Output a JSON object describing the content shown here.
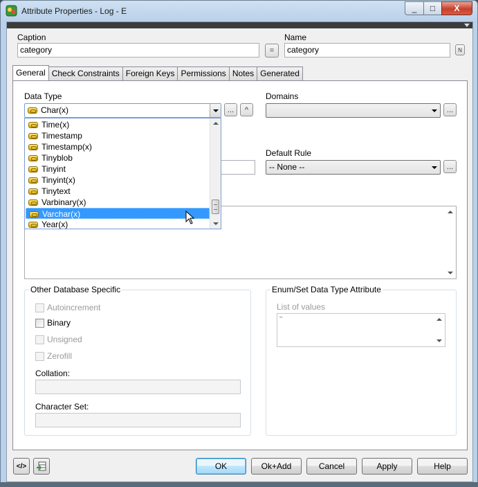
{
  "window": {
    "title": "Attribute Properties - Log - E"
  },
  "caption": {
    "label": "Caption",
    "value": "category",
    "equals_label": "="
  },
  "name": {
    "label": "Name",
    "value": "category",
    "n_label": "N"
  },
  "tabs": [
    {
      "label": "General"
    },
    {
      "label": "Check Constraints"
    },
    {
      "label": "Foreign Keys"
    },
    {
      "label": "Permissions"
    },
    {
      "label": "Notes"
    },
    {
      "label": "Generated"
    }
  ],
  "datatype": {
    "label": "Data Type",
    "selected": "Char(x)",
    "ellipsis": "...",
    "up": "^",
    "options": [
      {
        "label": "Time(x)"
      },
      {
        "label": "Timestamp"
      },
      {
        "label": "Timestamp(x)"
      },
      {
        "label": "Tinyblob"
      },
      {
        "label": "Tinyint"
      },
      {
        "label": "Tinyint(x)"
      },
      {
        "label": "Tinytext"
      },
      {
        "label": "Varbinary(x)"
      },
      {
        "label": "Varchar(x)"
      },
      {
        "label": "Year(x)"
      }
    ],
    "highlighted": "Varchar(x)"
  },
  "domains": {
    "label": "Domains",
    "value": "",
    "ellipsis": "..."
  },
  "default_rule": {
    "label": "Default Rule",
    "value": "-- None --",
    "ellipsis": "..."
  },
  "other_db": {
    "title": "Other Database Specific",
    "autoincrement": "Autoincrement",
    "binary": "Binary",
    "unsigned": "Unsigned",
    "zerofill": "Zerofill",
    "collation_label": "Collation:",
    "charset_label": "Character Set:"
  },
  "enumset": {
    "title": "Enum/Set Data Type Attribute",
    "list_label": "List of values",
    "list_value": "\""
  },
  "buttons": {
    "ok": "OK",
    "ok_add": "Ok+Add",
    "cancel": "Cancel",
    "apply": "Apply",
    "help": "Help",
    "left1": "</>"
  },
  "window_buttons": {
    "min": "_",
    "max": "□",
    "close": "X"
  }
}
